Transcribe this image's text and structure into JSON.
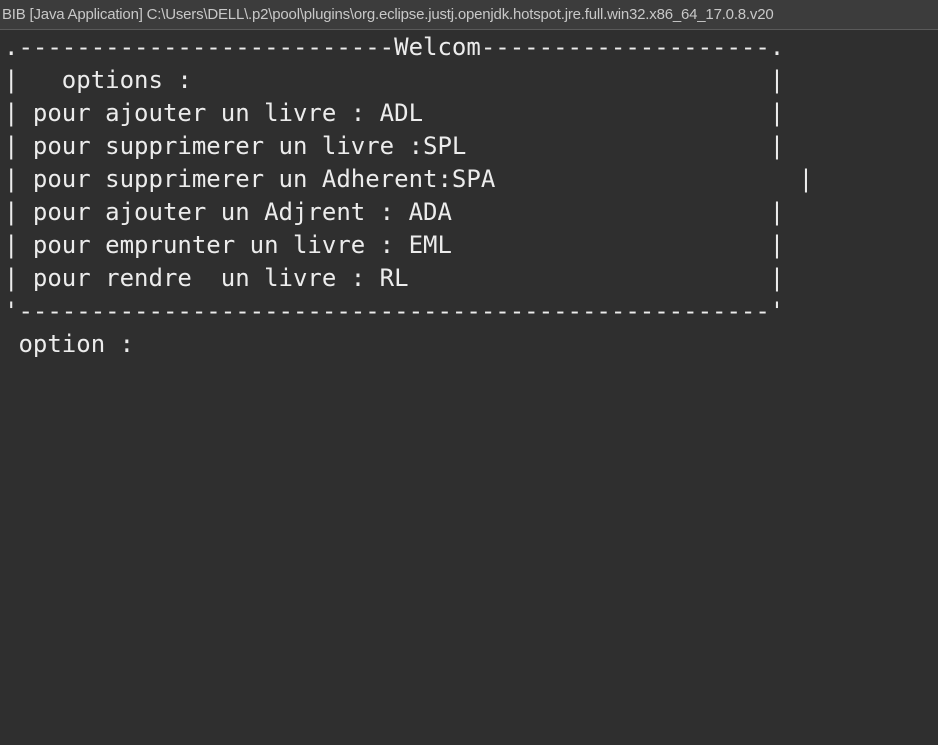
{
  "window": {
    "title": "BIB [Java Application] C:\\Users\\DELL\\.p2\\pool\\plugins\\org.eclipse.justj.openjdk.hotspot.jre.full.win32.x86_64_17.0.8.v20"
  },
  "console": {
    "lines": [
      ".--------------------------Welcom--------------------.",
      "|   options :                                        |",
      "| pour ajouter un livre : ADL                        |",
      "| pour supprimerer un livre :SPL                     |",
      "| pour supprimerer un Adherent:SPA                     |",
      "| pour ajouter un Adjrent : ADA                      |",
      "| pour emprunter un livre : EML                      |",
      "| pour rendre  un livre : RL                         |",
      "'----------------------------------------------------'",
      " option :"
    ]
  }
}
